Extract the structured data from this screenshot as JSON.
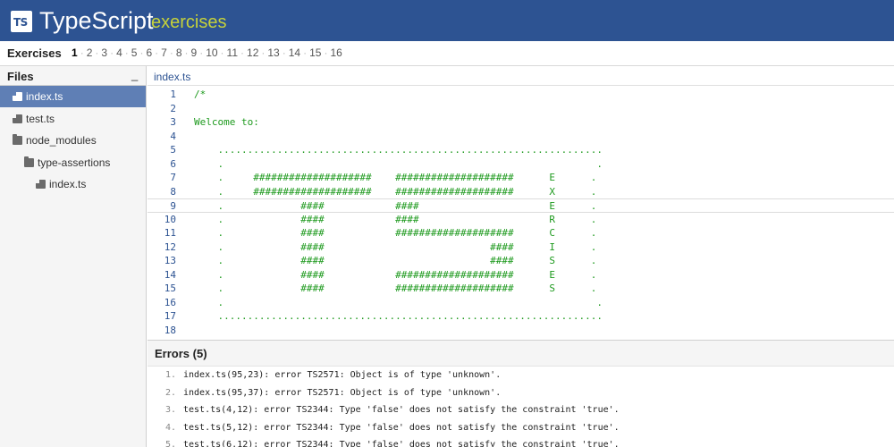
{
  "header": {
    "logo": "TS",
    "title": "TypeScript",
    "subtitle": "exercises",
    "bg_color": "#2d5392",
    "subtitle_color": "#c6d23a"
  },
  "exercise_nav": {
    "label": "Exercises",
    "items": [
      "1",
      "2",
      "3",
      "4",
      "5",
      "6",
      "7",
      "8",
      "9",
      "10",
      "11",
      "12",
      "13",
      "14",
      "15",
      "16"
    ],
    "active": "1"
  },
  "sidebar": {
    "title": "Files",
    "minimize_label": "_",
    "items": [
      {
        "label": "index.ts",
        "icon": "file-icon",
        "depth": 0,
        "selected": true
      },
      {
        "label": "test.ts",
        "icon": "file-icon",
        "depth": 0,
        "selected": false
      },
      {
        "label": "node_modules",
        "icon": "folder-icon",
        "depth": 0,
        "selected": false
      },
      {
        "label": "type-assertions",
        "icon": "folder-icon",
        "depth": 1,
        "selected": false
      },
      {
        "label": "index.ts",
        "icon": "file-icon",
        "depth": 2,
        "selected": false
      }
    ]
  },
  "editor": {
    "tab": "index.ts",
    "current_line": 9,
    "lines": [
      "/*",
      "",
      "Welcome to:",
      "",
      "    .................................................................",
      "    .                                                               .",
      "    .     ####################    ####################      E      .",
      "    .     ####################    ####################      X      .",
      "    .             ####            ####                      E      .",
      "    .             ####            ####                      R      .",
      "    .             ####            ####################      C      .",
      "    .             ####                            ####      I      .",
      "    .             ####                            ####      S      .",
      "    .             ####            ####################      E      .",
      "    .             ####            ####################      S      .",
      "    .                                                               .",
      "    .................................................................",
      ""
    ]
  },
  "errors": {
    "title": "Errors (5)",
    "items": [
      "index.ts(95,23): error TS2571: Object is of type 'unknown'.",
      "index.ts(95,37): error TS2571: Object is of type 'unknown'.",
      "test.ts(4,12): error TS2344: Type 'false' does not satisfy the constraint 'true'.",
      "test.ts(5,12): error TS2344: Type 'false' does not satisfy the constraint 'true'.",
      "test.ts(6,12): error TS2344: Type 'false' does not satisfy the constraint 'true'."
    ]
  }
}
